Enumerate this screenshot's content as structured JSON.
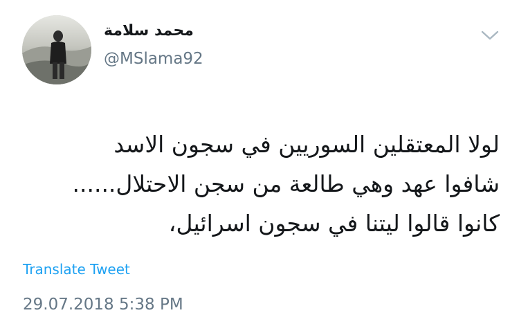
{
  "author": {
    "display_name": "محمد سلامة",
    "handle": "@MSlama92"
  },
  "tweet": {
    "lines": [
      "لولا المعتقلين السوريين في سجون الاسد",
      "شافوا عهد وهي طالعة من سجن الاحتلال......",
      "كانوا قالوا ليتنا في سجون اسرائيل،"
    ],
    "translate_label": "Translate Tweet",
    "timestamp": "29.07.2018 5:38 PM"
  },
  "icons": {
    "menu": "chevron-down-icon",
    "avatar": "avatar-photo"
  },
  "colors": {
    "link": "#1da1f2",
    "secondary_text": "#657786",
    "primary_text": "#14171a"
  }
}
